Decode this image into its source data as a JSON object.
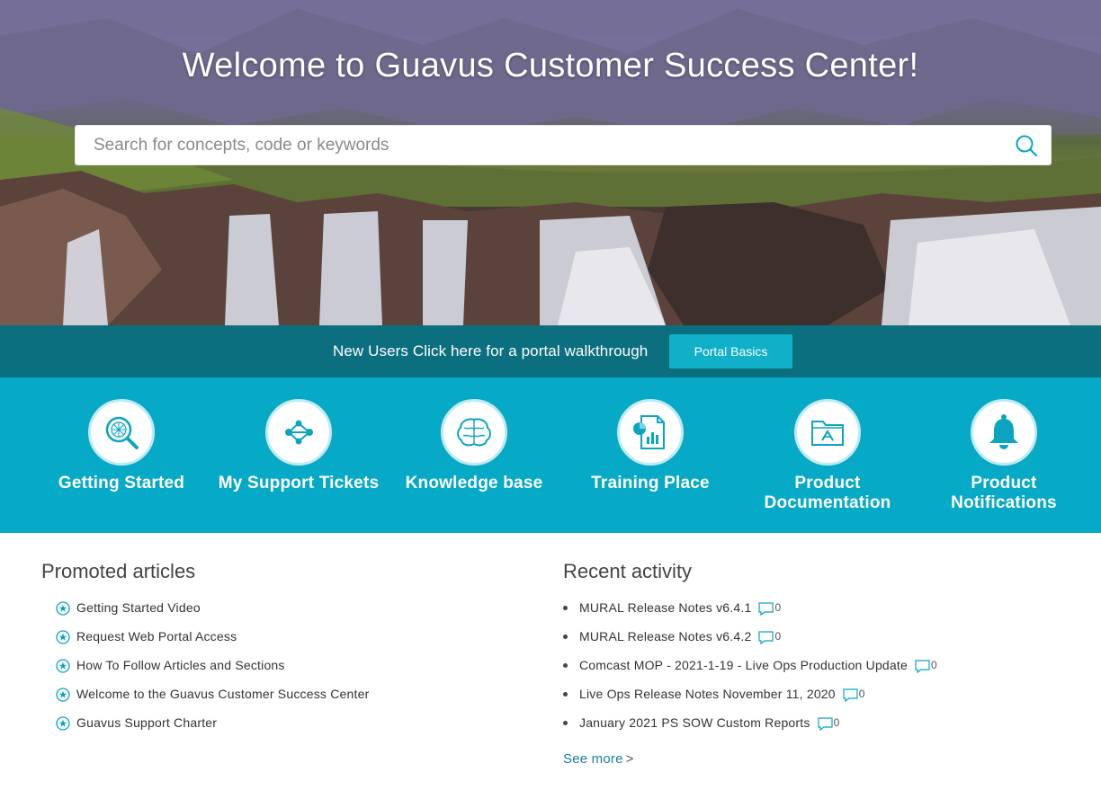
{
  "hero": {
    "title": "Welcome to Guavus Customer Success Center!",
    "search_placeholder": "Search for concepts, code or keywords",
    "search_value": ""
  },
  "walkthrough": {
    "text": "New Users Click here for a portal walkthrough",
    "button_label": "Portal Basics"
  },
  "categories": [
    {
      "label": "Getting Started",
      "icon": "magnifier-network-icon"
    },
    {
      "label": "My Support Tickets",
      "icon": "share-nodes-icon"
    },
    {
      "label": "Knowledge base",
      "icon": "brain-icon"
    },
    {
      "label": "Training Place",
      "icon": "chart-document-icon"
    },
    {
      "label": "Product Documentation",
      "icon": "folder-icon"
    },
    {
      "label": "Product Notifications",
      "icon": "bell-icon"
    }
  ],
  "promoted": {
    "title": "Promoted articles",
    "items": [
      "Getting Started Video",
      "Request Web Portal Access",
      "How To Follow Articles and Sections",
      "Welcome to the Guavus Customer Success Center",
      "Guavus Support Charter"
    ]
  },
  "recent": {
    "title": "Recent activity",
    "items": [
      {
        "title": "MURAL Release Notes v6.4.1",
        "comments": "0"
      },
      {
        "title": "MURAL Release Notes v6.4.2",
        "comments": "0"
      },
      {
        "title": "Comcast MOP - 2021-1-19 - Live Ops Production Update",
        "comments": "0"
      },
      {
        "title": "Live Ops Release Notes November 11, 2020",
        "comments": "0"
      },
      {
        "title": "January 2021 PS SOW Custom Reports",
        "comments": "0"
      }
    ],
    "see_more": "See more",
    "see_more_arrow": ">"
  },
  "colors": {
    "teal_dark": "#0b6f80",
    "teal": "#06a9c6",
    "button": "#0fb0c8",
    "link": "#1a7fa0"
  }
}
